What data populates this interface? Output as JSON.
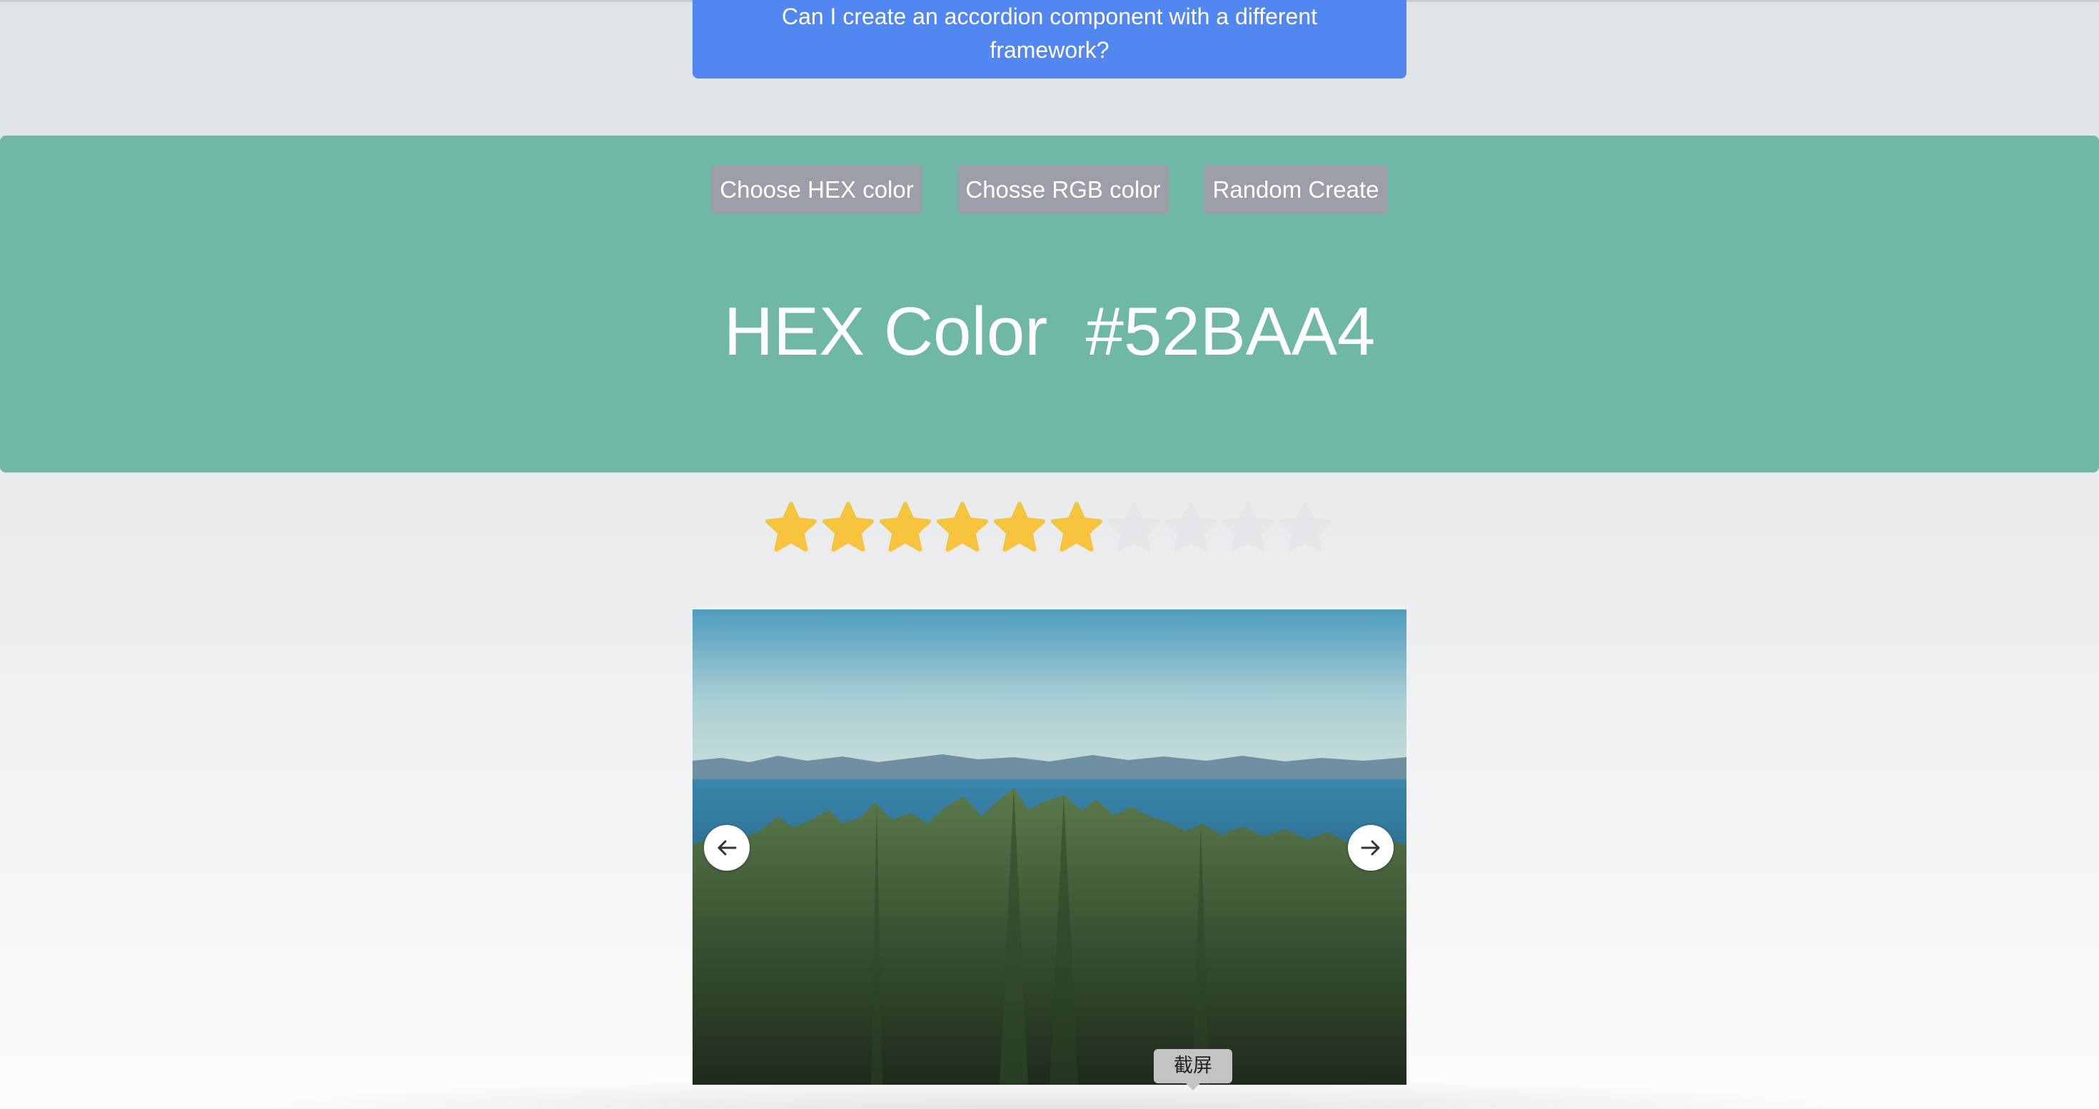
{
  "accordion": {
    "question_line1": "Can I create an accordion component with a different",
    "question_line2": "framework?"
  },
  "color_picker": {
    "background_color": "#6FB8A6",
    "buttons": {
      "hex_label": "Choose HEX color",
      "rgb_label": "Chosse RGB color",
      "random_label": "Random Create"
    },
    "title": "HEX Color  #52BAA4"
  },
  "rating": {
    "value": 6,
    "max": 10,
    "filled_color": "#F6C33D",
    "empty_color": "#E5E6EA"
  },
  "carousel": {
    "prev_icon": "arrow-left-icon",
    "next_icon": "arrow-right-icon"
  },
  "tooltip": {
    "label": "截屏"
  },
  "colors": {
    "accent_blue": "#5286F0",
    "button_gray": "#9C9EA9"
  }
}
